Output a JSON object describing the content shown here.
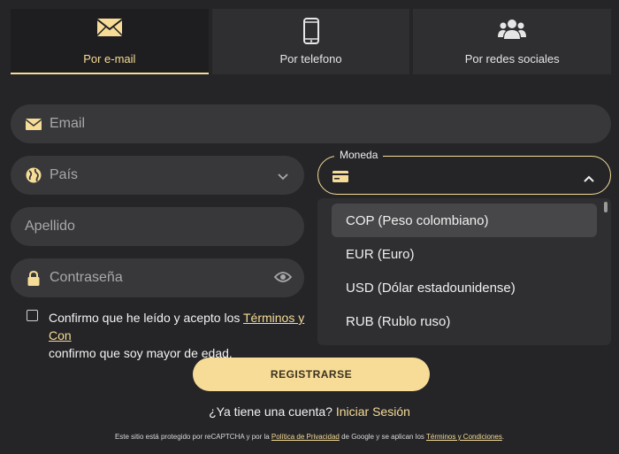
{
  "tabs": [
    {
      "label": "Por e-mail",
      "icon": "envelope-icon",
      "active": true
    },
    {
      "label": "Por telefono",
      "icon": "phone-icon",
      "active": false
    },
    {
      "label": "Por redes sociales",
      "icon": "users-icon",
      "active": false
    }
  ],
  "form": {
    "email_placeholder": "Email",
    "country_placeholder": "País",
    "lastname_placeholder": "Apellido",
    "password_placeholder": "Contraseña",
    "currency_label": "Moneda"
  },
  "currency_options": [
    {
      "label": "COP (Peso colombiano)",
      "selected": true
    },
    {
      "label": "EUR (Euro)",
      "selected": false
    },
    {
      "label": "USD (Dólar estadounidense)",
      "selected": false
    },
    {
      "label": "RUB (Rublo ruso)",
      "selected": false
    }
  ],
  "terms": {
    "prefix": "Confirmo que he leído y acepto los ",
    "link": "Términos y Con",
    "suffix": "confirmo que soy mayor de edad."
  },
  "register_label": "REGISTRARSE",
  "login": {
    "prompt": "¿Ya tiene una cuenta?",
    "link": "Iniciar Sesión"
  },
  "recaptcha": {
    "part1": "Este sitio está protegido por reCAPTCHA y por la ",
    "privacy_link": "Política de Privacidad",
    "part2": " de Google y se aplican los ",
    "terms_link": "Términos y Condiciones",
    "part3": "."
  },
  "colors": {
    "accent": "#f6dc96",
    "background": "#252528",
    "field": "#38383b"
  }
}
